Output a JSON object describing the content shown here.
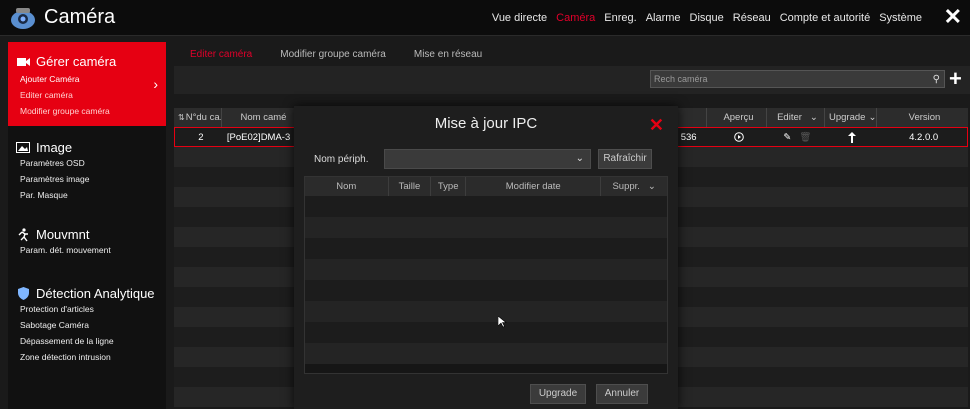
{
  "app": {
    "title": "Caméra",
    "close_label": "✕"
  },
  "topnav": [
    {
      "label": "Vue directe",
      "active": false
    },
    {
      "label": "Caméra",
      "active": true
    },
    {
      "label": "Enreg.",
      "active": false
    },
    {
      "label": "Alarme",
      "active": false
    },
    {
      "label": "Disque",
      "active": false
    },
    {
      "label": "Réseau",
      "active": false
    },
    {
      "label": "Compte et autorité",
      "active": false
    },
    {
      "label": "Système",
      "active": false
    }
  ],
  "sidebar": {
    "gerer": {
      "title": "Gérer caméra",
      "items": [
        "Ajouter Caméra",
        "Editer caméra",
        "Modifier groupe caméra"
      ]
    },
    "image": {
      "title": "Image",
      "items": [
        "Paramètres OSD",
        "Paramètres image",
        "Par. Masque"
      ]
    },
    "mouv": {
      "title": "Mouvmnt",
      "items": [
        "Param. dét. mouvement"
      ]
    },
    "detect": {
      "title": "Détection Analytique",
      "items": [
        "Protection d'articles",
        "Sabotage Caméra",
        "Dépassement de la ligne",
        "Zone détection intrusion"
      ]
    }
  },
  "subtabs": [
    "Editer caméra",
    "Modifier groupe caméra",
    "Mise en réseau"
  ],
  "search": {
    "placeholder": "Rech caméra"
  },
  "table": {
    "headers": {
      "num": "N°du ca..",
      "name": "Nom camé",
      "apercu": "Aperçu",
      "editer": "Editer",
      "upgrade": "Upgrade",
      "version": "Version"
    },
    "row": {
      "num": "2",
      "name": "[PoE02]DMA-3",
      "port": "536",
      "version": "4.2.0.0"
    }
  },
  "modal": {
    "title": "Mise à jour IPC",
    "device_label": "Nom périph.",
    "refresh": "Rafraîchir",
    "columns": {
      "nom": "Nom",
      "taille": "Taille",
      "type": "Type",
      "date": "Modifier date",
      "suppr": "Suppr."
    },
    "upgrade": "Upgrade",
    "cancel": "Annuler"
  }
}
